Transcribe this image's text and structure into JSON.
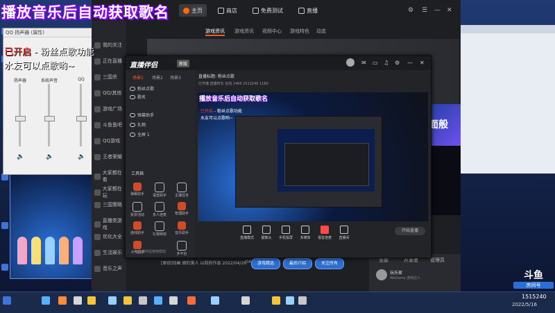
{
  "overlay": {
    "title": "播放音乐后自动获取歌名",
    "status_on": "已开启",
    "status_rest": " - 粉丝点歌功能",
    "hint": "水友可以点歌哟~"
  },
  "volume_panel": {
    "title": "QQ 扬声器 (属性)",
    "columns": [
      {
        "label": "扬声器",
        "level": 0.45
      },
      {
        "label": "系统声音",
        "level": 0.45
      },
      {
        "label": "QQ",
        "level": 0.45
      }
    ]
  },
  "douyu": {
    "tabs": [
      "主页",
      "商店",
      "免费测试",
      "直播"
    ],
    "search_placeholder": "搜索全网",
    "nav": [
      "游戏资讯",
      "游戏资讯",
      "视频中心",
      "游戏特色",
      "动态"
    ],
    "sidebar": [
      "我的关注",
      "正在直播",
      "三国杀",
      "QQ/其他",
      "游戏广场",
      "斗鱼鱼吧",
      "QQ游戏",
      "王者荣耀",
      "大家都在看",
      "大家都在玩",
      "三国策略",
      "直播类游戏",
      "优化大全",
      "生活娱乐",
      "音乐之声"
    ],
    "banner_text": "面般",
    "pills": [
      "游戏精选",
      "最后介绍",
      "关注所有"
    ],
    "caption": "[原创]动画 婉约美人 以前的作品 2022/04/26",
    "caption_time": "04:28",
    "right_tabs": [
      "全部",
      "开发者",
      "管理员"
    ],
    "right_user": "玩乐家",
    "right_user_sub": "WeGame 游戏达人"
  },
  "companion": {
    "logo": "直播伴侣",
    "badge": "新版",
    "left_tabs": [
      "场景1",
      "场景2",
      "场景3"
    ],
    "layers": [
      "粉丝点歌",
      "歌名",
      "弹幕助手",
      "礼物",
      "全屏 1"
    ],
    "toolbox_label": "工具箱",
    "tools": [
      "弹幕助手",
      "语音助手",
      "主播任务",
      "投票活动",
      "多人连麦",
      "管理助手",
      "连线助手",
      "礼物特效",
      "音乐助手",
      "人气助手",
      "多平台"
    ],
    "tools_footer": "斗鱼直播伴侣使用帮助",
    "info": "直播标题: 粉丝点歌",
    "info_tag": "推荐",
    "info2": "已开播  直播时长  在线 1466  1513246  1180",
    "bottom": [
      "直播模式",
      "摄像头",
      "手机投屏",
      "多媒体",
      "语音连麦",
      "直播间"
    ],
    "start": "开始直播"
  },
  "taskbar": {
    "time": "18:10",
    "date": "2022/5/16",
    "watermark_main": "斗鱼",
    "watermark_sub": "房间号",
    "tray_extra": "1515240"
  },
  "icons": [
    "home-icon",
    "shop-icon",
    "gift-icon",
    "tv-icon",
    "speaker-icon",
    "eye-icon",
    "search-icon",
    "close-icon",
    "minimize-icon",
    "maximize-icon",
    "settings-icon"
  ]
}
